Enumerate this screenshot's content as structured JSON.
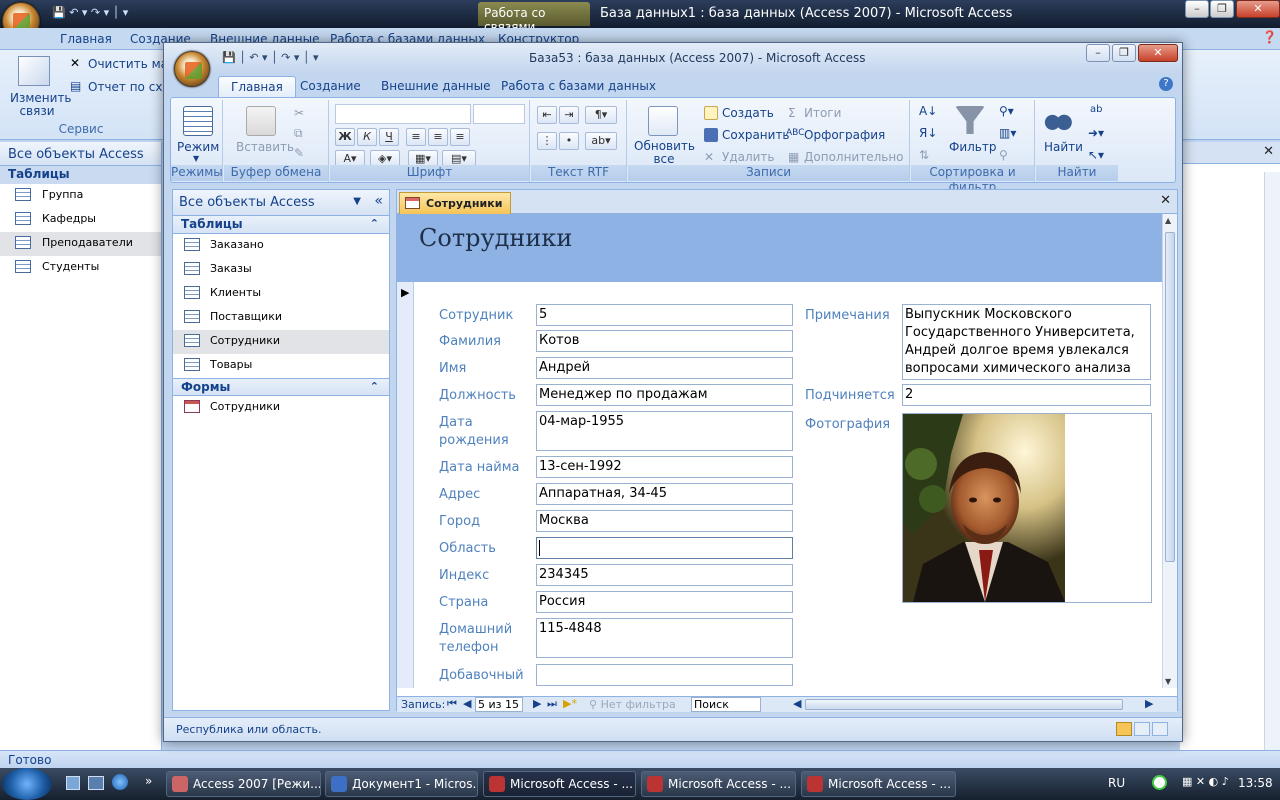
{
  "background_app": {
    "title": "База данных1 : база данных (Access 2007) - Microsoft Access",
    "context_tab": "Работа со связями",
    "tabs": [
      "Главная",
      "Создание",
      "Внешние данные",
      "Работа с базами данных",
      "Конструктор"
    ],
    "ribbon": {
      "edit_relations": "Изменить связи",
      "clear_layout": "Очистить мак",
      "report": "Отчет по схем",
      "group": "Сервис"
    },
    "nav": {
      "header": "Все объекты Access",
      "section": "Таблицы",
      "items": [
        "Группа",
        "Кафедры",
        "Преподаватели",
        "Студенты"
      ]
    },
    "status": "Готово"
  },
  "taskbar": {
    "buttons": [
      "Access 2007 [Режи...",
      "Документ1 - Micros...",
      "Microsoft Access - ...",
      "Microsoft Access - ...",
      "Microsoft Access - ..."
    ],
    "lang": "RU",
    "clock": "13:58"
  },
  "window": {
    "title": "База53 : база данных (Access 2007) - Microsoft Access",
    "tabs": [
      "Главная",
      "Создание",
      "Внешние данные",
      "Работа с базами данных"
    ],
    "ribbon": {
      "views": {
        "mode": "Режим",
        "group": "Режимы"
      },
      "clipboard": {
        "paste": "Вставить",
        "group": "Буфер обмена"
      },
      "font": {
        "group": "Шрифт",
        "bold": "Ж",
        "italic": "К",
        "underline": "Ч"
      },
      "rtf": {
        "group": "Текст RTF"
      },
      "records": {
        "refresh": "Обновить все",
        "new": "Создать",
        "save": "Сохранить",
        "delete": "Удалить",
        "totals": "Итоги",
        "spelling": "Орфография",
        "more": "Дополнительно",
        "group": "Записи"
      },
      "sort": {
        "filter": "Фильтр",
        "group": "Сортировка и фильтр"
      },
      "find": {
        "find": "Найти",
        "group": "Найти"
      }
    },
    "nav": {
      "header": "Все объекты Access",
      "sections": [
        {
          "title": "Таблицы",
          "items": [
            "Заказано",
            "Заказы",
            "Клиенты",
            "Поставщики",
            "Сотрудники",
            "Товары"
          ],
          "selected": "Сотрудники"
        },
        {
          "title": "Формы",
          "items": [
            "Сотрудники"
          ]
        }
      ]
    },
    "form": {
      "tab": "Сотрудники",
      "title": "Сотрудники",
      "fields": {
        "employee": {
          "label": "Сотрудник",
          "value": "5"
        },
        "last_name": {
          "label": "Фамилия",
          "value": "Котов"
        },
        "first_name": {
          "label": "Имя",
          "value": "Андрей"
        },
        "position": {
          "label": "Должность",
          "value": "Менеджер по продажам"
        },
        "birth_date": {
          "label": "Дата рождения",
          "value": "04-мар-1955"
        },
        "hire_date": {
          "label": "Дата найма",
          "value": "13-сен-1992"
        },
        "address": {
          "label": "Адрес",
          "value": "Аппаратная, 34-45"
        },
        "city": {
          "label": "Город",
          "value": "Москва"
        },
        "region": {
          "label": "Область",
          "value": ""
        },
        "zip": {
          "label": "Индекс",
          "value": "234345"
        },
        "country": {
          "label": "Страна",
          "value": "Россия"
        },
        "home_phone": {
          "label": "Домашний телефон",
          "value": "115-4848"
        },
        "extension": {
          "label": "Добавочный",
          "value": ""
        },
        "notes": {
          "label": "Примечания",
          "value": "Выпускник Московского Государственного Университета, Андрей долгое время увлекался вопросами химического анализа"
        },
        "reports_to": {
          "label": "Подчиняется",
          "value": "2"
        },
        "photo": {
          "label": "Фотография"
        }
      },
      "record_nav": {
        "label": "Запись:",
        "current": "5 из 15",
        "filter": "Нет фильтра",
        "search": "Поиск"
      }
    },
    "status": "Республика или область."
  },
  "colors": {
    "accent": "#8db2e3",
    "label": "#4f81bd",
    "tab": "#f6c457"
  }
}
